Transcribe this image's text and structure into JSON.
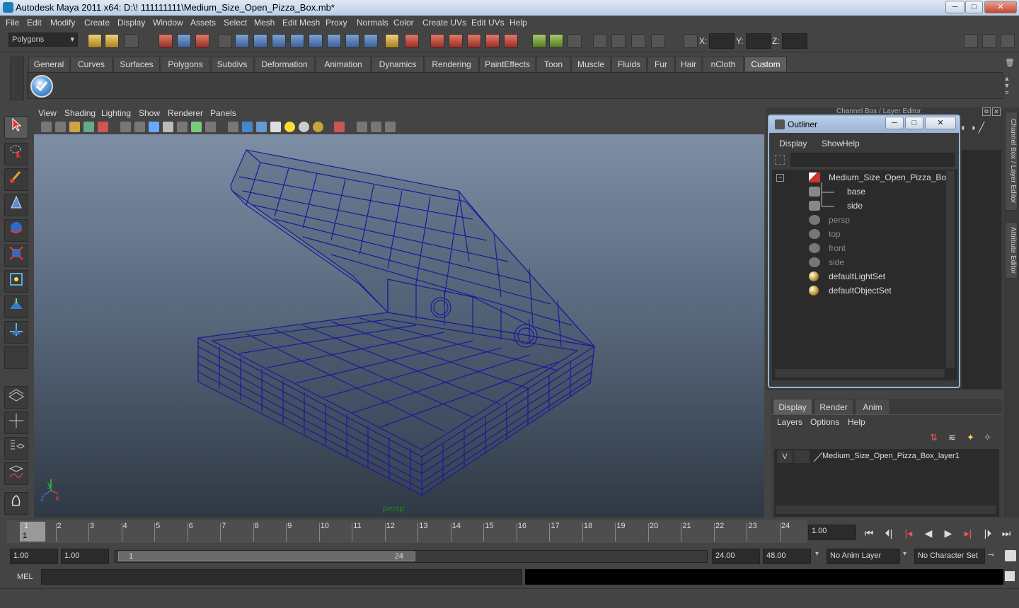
{
  "window": {
    "title": "Autodesk Maya 2011 x64: D:\\! 111111111\\Medium_Size_Open_Pizza_Box.mb*",
    "min": "─",
    "max": "□",
    "close": "✕"
  },
  "menubar": [
    "File",
    "Edit",
    "Modify",
    "Create",
    "Display",
    "Window",
    "Assets",
    "Select",
    "Mesh",
    "Edit Mesh",
    "Proxy",
    "Normals",
    "Color",
    "Create UVs",
    "Edit UVs",
    "Help"
  ],
  "statusline": {
    "mode": "Polygons",
    "x_label": "X:",
    "y_label": "Y:",
    "z_label": "Z:"
  },
  "shelf_tabs": [
    {
      "label": "General"
    },
    {
      "label": "Curves"
    },
    {
      "label": "Surfaces"
    },
    {
      "label": "Polygons"
    },
    {
      "label": "Subdivs"
    },
    {
      "label": "Deformation"
    },
    {
      "label": "Animation"
    },
    {
      "label": "Dynamics"
    },
    {
      "label": "Rendering"
    },
    {
      "label": "PaintEffects"
    },
    {
      "label": "Toon"
    },
    {
      "label": "Muscle"
    },
    {
      "label": "Fluids"
    },
    {
      "label": "Fur"
    },
    {
      "label": "Hair"
    },
    {
      "label": "nCloth"
    },
    {
      "label": "Custom",
      "active": true
    }
  ],
  "viewport": {
    "menus": [
      "View",
      "Shading",
      "Lighting",
      "Show",
      "Renderer",
      "Panels"
    ],
    "camera_label": "persp",
    "axis_x": "x",
    "axis_y": "y",
    "axis_z": "z"
  },
  "channel_box": {
    "title": "Channel Box / Layer Editor"
  },
  "side_tabs": {
    "channel": "Channel Box / Layer Editor",
    "attribute": "Attribute Editor"
  },
  "outliner": {
    "title": "Outliner",
    "menus": [
      "Display",
      "Show",
      "Help"
    ],
    "items": [
      {
        "label": "Medium_Size_Open_Pizza_Box",
        "type": "group",
        "dim": false
      },
      {
        "label": "base",
        "type": "mesh",
        "dim": false
      },
      {
        "label": "side",
        "type": "mesh",
        "dim": false
      },
      {
        "label": "persp",
        "type": "camera",
        "dim": true
      },
      {
        "label": "top",
        "type": "camera",
        "dim": true
      },
      {
        "label": "front",
        "type": "camera",
        "dim": true
      },
      {
        "label": "side",
        "type": "camera",
        "dim": true
      },
      {
        "label": "defaultLightSet",
        "type": "set",
        "dim": false
      },
      {
        "label": "defaultObjectSet",
        "type": "set",
        "dim": false
      }
    ]
  },
  "layer_editor": {
    "tabs": [
      "Display",
      "Render",
      "Anim"
    ],
    "menus": [
      "Layers",
      "Options",
      "Help"
    ],
    "layer_v": "V",
    "layer_name": "Medium_Size_Open_Pizza_Box_layer1"
  },
  "timeline": {
    "ticks": [
      1,
      2,
      3,
      4,
      5,
      6,
      7,
      8,
      9,
      10,
      11,
      12,
      13,
      14,
      15,
      16,
      17,
      18,
      19,
      20,
      21,
      22,
      23,
      24
    ],
    "current_frame": "1",
    "current_time": "1.00"
  },
  "range": {
    "start": "1.00",
    "playback_start": "1.00",
    "slider_start": "1",
    "slider_end": "24",
    "playback_end": "24.00",
    "end": "48.00",
    "anim_layer": "No Anim Layer",
    "character_set": "No Character Set"
  },
  "cmdline": {
    "label": "MEL"
  }
}
